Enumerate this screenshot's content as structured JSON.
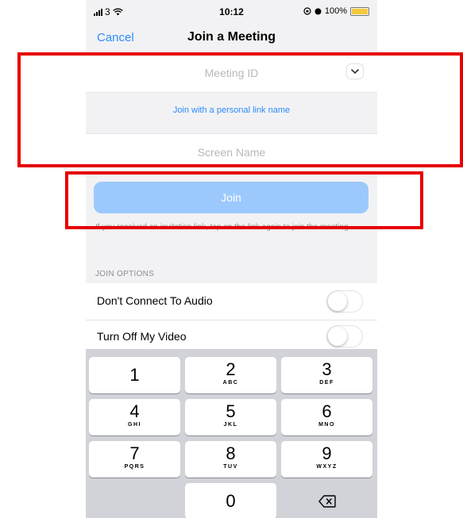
{
  "status_bar": {
    "carrier": "3",
    "time": "10:12",
    "battery": "100%"
  },
  "nav": {
    "cancel_label": "Cancel",
    "title": "Join a Meeting"
  },
  "form": {
    "meeting_id_placeholder": "Meeting ID",
    "personal_link_label": "Join with a personal link name",
    "screen_name_placeholder": "Screen Name",
    "join_label": "Join",
    "hint": "If you received an invitation link, tap on the link again to join the meeting"
  },
  "join_options": {
    "section_label": "JOIN OPTIONS",
    "items": [
      {
        "label": "Don't Connect To Audio",
        "on": false
      },
      {
        "label": "Turn Off My Video",
        "on": false
      }
    ]
  },
  "keypad": {
    "keys": [
      {
        "num": "1",
        "letters": ""
      },
      {
        "num": "2",
        "letters": "ABC"
      },
      {
        "num": "3",
        "letters": "DEF"
      },
      {
        "num": "4",
        "letters": "GHI"
      },
      {
        "num": "5",
        "letters": "JKL"
      },
      {
        "num": "6",
        "letters": "MNO"
      },
      {
        "num": "7",
        "letters": "PQRS"
      },
      {
        "num": "8",
        "letters": "TUV"
      },
      {
        "num": "9",
        "letters": "WXYZ"
      },
      {
        "num": "0",
        "letters": ""
      }
    ],
    "delete_icon": "delete-backspace-icon"
  },
  "colors": {
    "accent": "#2d8cff",
    "join_button": "#9cc9fd",
    "highlight": "#e60000"
  }
}
